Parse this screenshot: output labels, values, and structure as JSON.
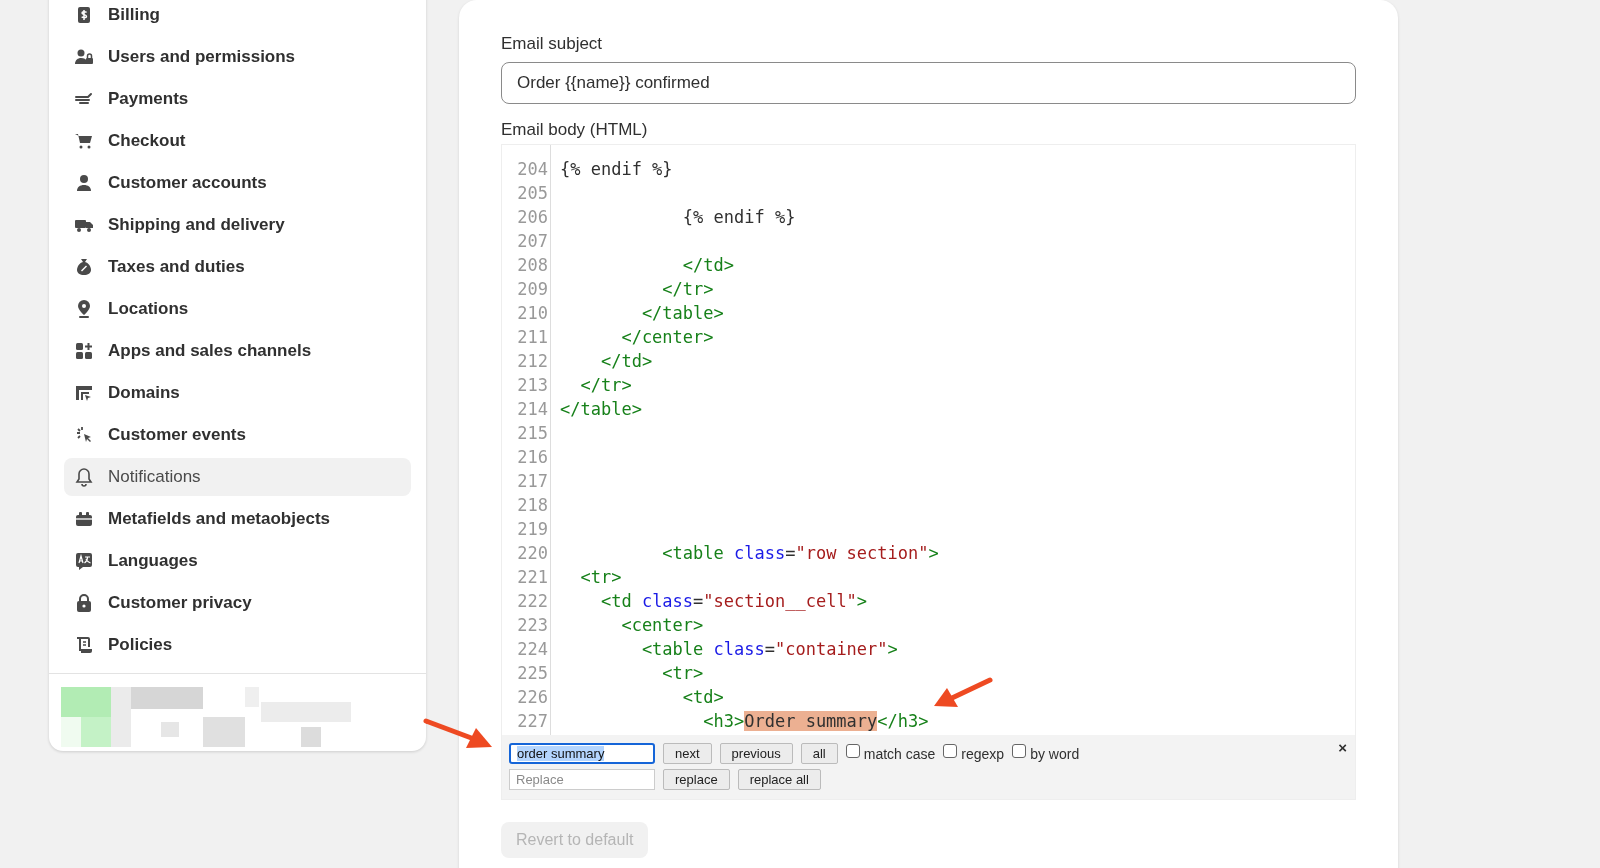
{
  "sidebar": {
    "items": [
      {
        "label": "Billing",
        "selected": false
      },
      {
        "label": "Users and permissions",
        "selected": false
      },
      {
        "label": "Payments",
        "selected": false
      },
      {
        "label": "Checkout",
        "selected": false
      },
      {
        "label": "Customer accounts",
        "selected": false
      },
      {
        "label": "Shipping and delivery",
        "selected": false
      },
      {
        "label": "Taxes and duties",
        "selected": false
      },
      {
        "label": "Locations",
        "selected": false
      },
      {
        "label": "Apps and sales channels",
        "selected": false
      },
      {
        "label": "Domains",
        "selected": false
      },
      {
        "label": "Customer events",
        "selected": false
      },
      {
        "label": "Notifications",
        "selected": true
      },
      {
        "label": "Metafields and metaobjects",
        "selected": false
      },
      {
        "label": "Languages",
        "selected": false
      },
      {
        "label": "Customer privacy",
        "selected": false
      },
      {
        "label": "Policies",
        "selected": false
      }
    ]
  },
  "subject": {
    "label": "Email subject",
    "value": "Order {{name}} confirmed"
  },
  "body": {
    "label": "Email body (HTML)",
    "lines": [
      {
        "number": "204",
        "tokens": [
          {
            "kind": "text",
            "text": "{% endif %}"
          }
        ]
      },
      {
        "number": "205"
      },
      {
        "number": "206",
        "tokens": [
          {
            "kind": "text",
            "text": "            {% endif %}"
          }
        ]
      },
      {
        "number": "207"
      },
      {
        "number": "208",
        "tokens": [
          {
            "kind": "tag",
            "text": "            </td>"
          }
        ]
      },
      {
        "number": "209",
        "tokens": [
          {
            "kind": "tag",
            "text": "          </tr>"
          }
        ]
      },
      {
        "number": "210",
        "tokens": [
          {
            "kind": "tag",
            "text": "        </table>"
          }
        ]
      },
      {
        "number": "211",
        "tokens": [
          {
            "kind": "tag",
            "text": "      </center>"
          }
        ]
      },
      {
        "number": "212",
        "tokens": [
          {
            "kind": "tag",
            "text": "    </td>"
          }
        ]
      },
      {
        "number": "213",
        "tokens": [
          {
            "kind": "tag",
            "text": "  </tr>"
          }
        ]
      },
      {
        "number": "214",
        "tokens": [
          {
            "kind": "tag",
            "text": "</table>"
          }
        ]
      },
      {
        "number": "215"
      },
      {
        "number": "216"
      },
      {
        "number": "217"
      },
      {
        "number": "218"
      },
      {
        "number": "219"
      },
      {
        "number": "220",
        "tokens": [
          {
            "kind": "tag",
            "text": "          <table "
          },
          {
            "kind": "attr",
            "text": "class"
          },
          {
            "kind": "text",
            "text": "="
          },
          {
            "kind": "string",
            "text": "\"row section\""
          },
          {
            "kind": "tag",
            "text": ">"
          }
        ]
      },
      {
        "number": "221",
        "tokens": [
          {
            "kind": "tag",
            "text": "  <tr>"
          }
        ]
      },
      {
        "number": "222",
        "tokens": [
          {
            "kind": "tag",
            "text": "    <td "
          },
          {
            "kind": "attr",
            "text": "class"
          },
          {
            "kind": "text",
            "text": "="
          },
          {
            "kind": "string",
            "text": "\"section__cell\""
          },
          {
            "kind": "tag",
            "text": ">"
          }
        ]
      },
      {
        "number": "223",
        "tokens": [
          {
            "kind": "tag",
            "text": "      <center>"
          }
        ]
      },
      {
        "number": "224",
        "tokens": [
          {
            "kind": "tag",
            "text": "        <table "
          },
          {
            "kind": "attr",
            "text": "class"
          },
          {
            "kind": "text",
            "text": "="
          },
          {
            "kind": "string",
            "text": "\"container\""
          },
          {
            "kind": "tag",
            "text": ">"
          }
        ]
      },
      {
        "number": "225",
        "tokens": [
          {
            "kind": "tag",
            "text": "          <tr>"
          }
        ]
      },
      {
        "number": "226",
        "tokens": [
          {
            "kind": "tag",
            "text": "            <td>"
          }
        ]
      },
      {
        "number": "227",
        "tokens": [
          {
            "kind": "tag",
            "text": "              <h3>"
          },
          {
            "kind": "match",
            "text": "Order summary"
          },
          {
            "kind": "tag",
            "text": "</h3>"
          }
        ]
      }
    ]
  },
  "find": {
    "query": "order summary",
    "replace_placeholder": "Replace",
    "buttons": [
      "next",
      "previous",
      "all"
    ],
    "options": [
      {
        "label": "match case",
        "checked": false
      },
      {
        "label": "regexp",
        "checked": false
      },
      {
        "label": "by word",
        "checked": false
      }
    ],
    "replace_buttons": [
      "replace",
      "replace all"
    ],
    "close": "×"
  },
  "revert": {
    "label": "Revert to default",
    "disabled": true
  }
}
